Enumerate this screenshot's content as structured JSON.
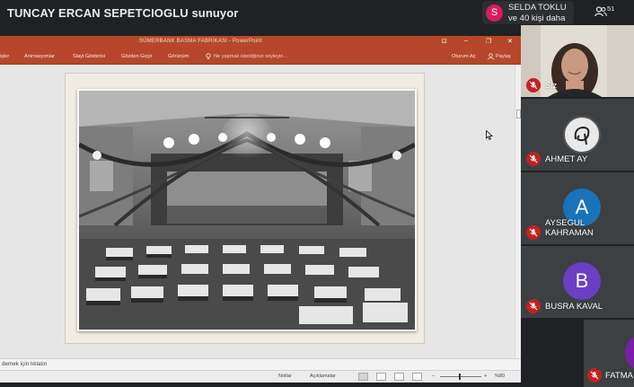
{
  "meeting": {
    "presenter_text": "TUNCAY ERCAN SEPETCIOGLU sunuyor",
    "joined_initial": "S",
    "joined_line1": "SELDA TOKLU",
    "joined_line2": "ve 40 kişi daha",
    "people_count": "51",
    "accent_avatar": "#d81b60"
  },
  "powerpoint": {
    "doc_title": "SÜMERBANK BASMA FABRİKASI  -  PowerPoint",
    "window_buttons": [
      "⊡",
      "–",
      "❐",
      "✕"
    ],
    "tabs": [
      "işler",
      "Animasyonlar",
      "Slayt Gösterisi",
      "Gözden Geçir",
      "Görünüm"
    ],
    "tell_me": "Ne yapmak istediğinizi söyleyin...",
    "signin": "Oturum Aç",
    "share": "Paylaş",
    "notes_placeholder": "demek için tıklatın",
    "status_notes": "Notlar",
    "status_comments": "Açıklamalar",
    "zoom_minus": "–",
    "zoom_plus": "+",
    "zoom_level": "%80",
    "ribbon_color": "#b7472a"
  },
  "participants": [
    {
      "name": "Siz",
      "kind": "video"
    },
    {
      "name": "AHMET AY",
      "kind": "logo",
      "initial": ""
    },
    {
      "name": "AYSEGUL KAHRAMAN",
      "kind": "initial",
      "initial": "A",
      "color": "#1a73b8"
    },
    {
      "name": "BUSRA KAVAL",
      "kind": "initial",
      "initial": "B",
      "color": "#6a3fc4"
    },
    {
      "name": "FATMA",
      "kind": "initial",
      "initial": "",
      "color": "#7b1fa2"
    }
  ]
}
